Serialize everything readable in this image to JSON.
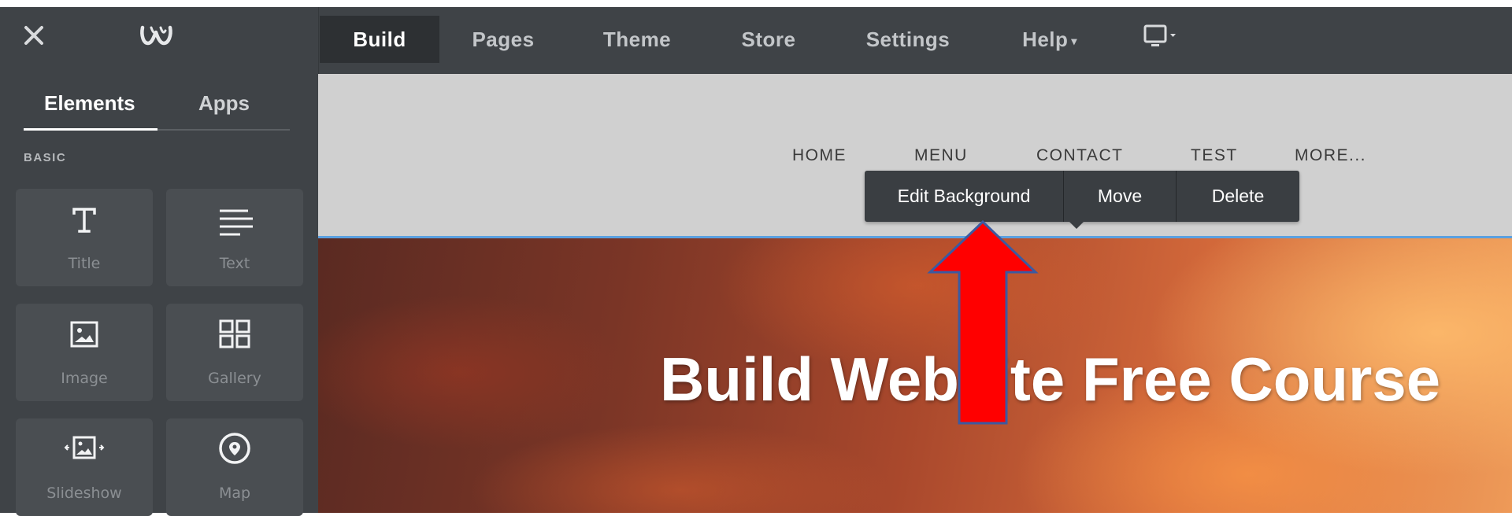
{
  "topbar": {
    "close_icon": "close-x-icon",
    "logo_icon": "weebly-w-logo",
    "tabs": [
      {
        "label": "Build",
        "active": true
      },
      {
        "label": "Pages",
        "active": false
      },
      {
        "label": "Theme",
        "active": false
      },
      {
        "label": "Store",
        "active": false
      },
      {
        "label": "Settings",
        "active": false
      },
      {
        "label": "Help",
        "active": false
      }
    ],
    "device_icon": "device-preview-icon"
  },
  "sidebar": {
    "tabs": [
      {
        "label": "Elements",
        "active": true
      },
      {
        "label": "Apps",
        "active": false
      }
    ],
    "section_label": "BASIC",
    "tiles": [
      {
        "label": "Title",
        "icon": "title-icon"
      },
      {
        "label": "Text",
        "icon": "text-icon"
      },
      {
        "label": "Image",
        "icon": "image-icon"
      },
      {
        "label": "Gallery",
        "icon": "gallery-icon"
      },
      {
        "label": "Slideshow",
        "icon": "slideshow-icon"
      },
      {
        "label": "Map",
        "icon": "map-pin-icon"
      }
    ]
  },
  "site": {
    "nav": [
      "HOME",
      "MENU",
      "CONTACT",
      "TEST",
      "MORE..."
    ],
    "hero_title": "Build Website Free Course"
  },
  "toolbar": {
    "edit_background": "Edit Background",
    "move": "Move",
    "delete": "Delete"
  },
  "colors": {
    "topbar_bg": "#3f4347",
    "active_tab_bg": "#2d3033",
    "header_bg": "#d0d0d0",
    "arrow_red": "#ff0000",
    "arrow_outline": "#3c5aa0"
  }
}
